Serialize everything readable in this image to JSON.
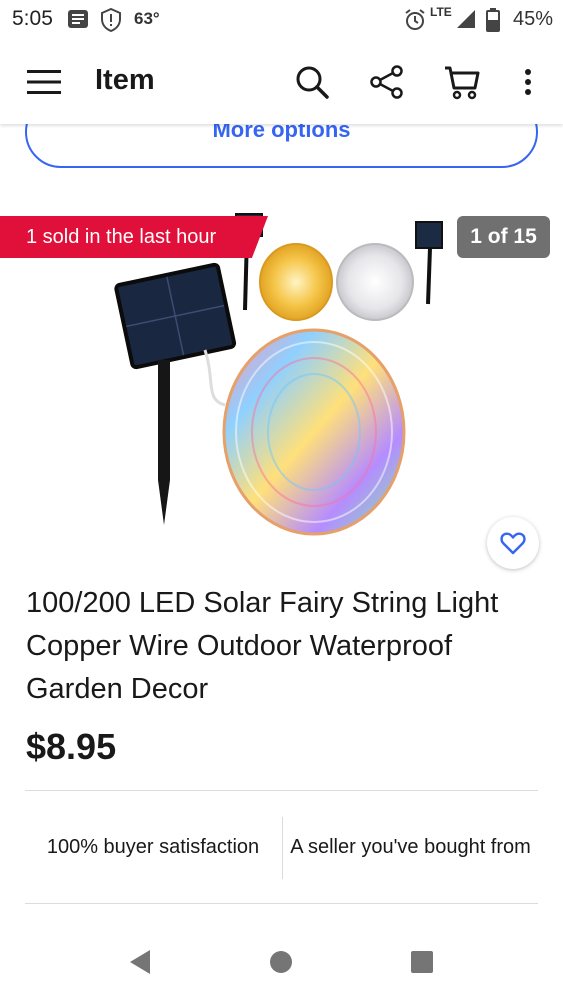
{
  "status_bar": {
    "time": "5:05",
    "temperature": "63°",
    "network": "LTE",
    "battery": "45%",
    "icons": [
      "message-icon",
      "alert-shield-icon",
      "alarm-icon",
      "signal-icon",
      "battery-icon"
    ]
  },
  "app_bar": {
    "title": "Item",
    "icons": [
      "menu-icon",
      "search-icon",
      "share-icon",
      "cart-icon",
      "overflow-menu-icon"
    ]
  },
  "more_options": {
    "label": "More options"
  },
  "product": {
    "sold_badge": "1 sold in the last hour",
    "photo_counter": "1 of 15",
    "title": "100/200 LED Solar Fairy String Light Copper Wire Outdoor Waterproof Garden Decor",
    "price": "$8.95"
  },
  "info": {
    "satisfaction": "100% buyer satisfaction",
    "seller_note": "A seller you've bought from"
  },
  "colors": {
    "accent_blue": "#3665f3",
    "badge_red": "#e0103a",
    "counter_gray": "#707070"
  },
  "nav_bar": {
    "icons": [
      "back-icon",
      "home-icon",
      "recents-icon"
    ]
  }
}
